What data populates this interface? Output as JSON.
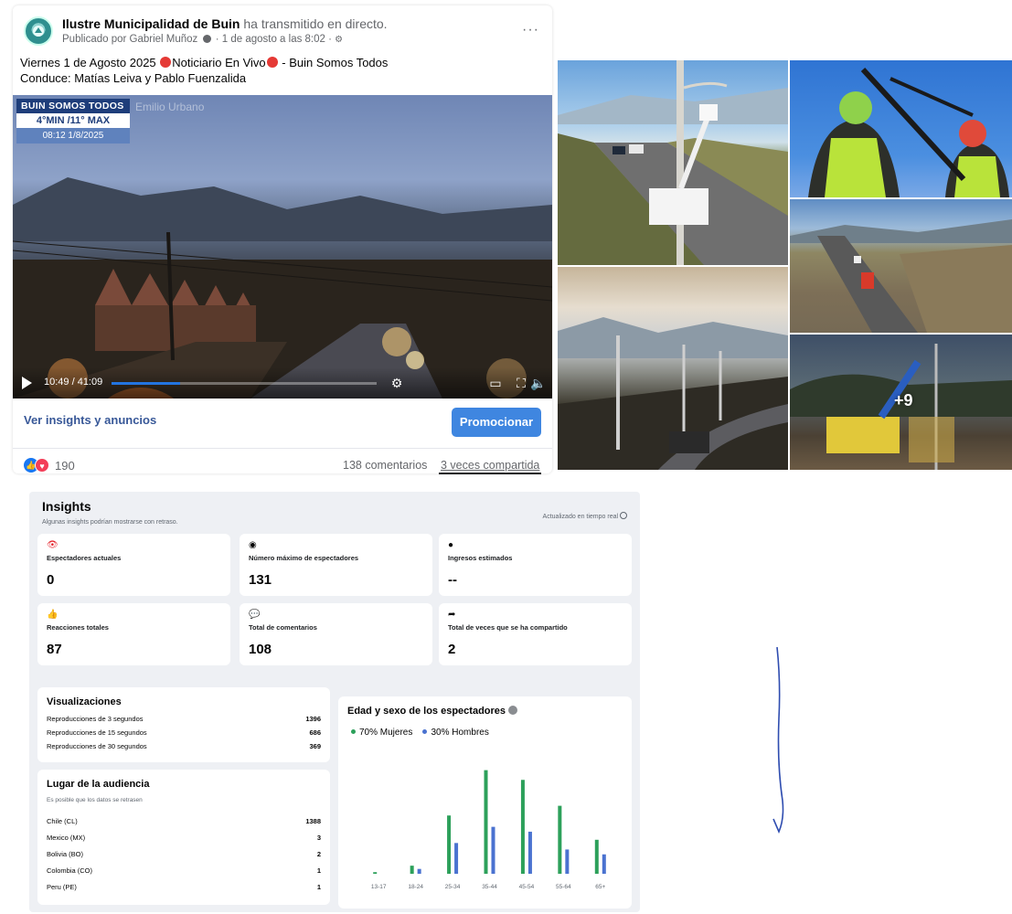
{
  "post": {
    "page_name": "Ilustre Municipalidad de Buin",
    "action_text": "ha transmitido en directo.",
    "published_by": "Publicado por Gabriel Muñoz",
    "date_text": "1 de agosto a las 8:02",
    "more_label": "···",
    "title_part1": "Viernes 1 de Agosto 2025",
    "title_part2": "Noticiario En Vivo",
    "title_part3": "- Buin Somos Todos",
    "subtitle": "Conduce: Matías Leiva y Pablo Fuenzalida",
    "video": {
      "overlay_title": "BUIN SOMOS TODOS",
      "overlay_temp": "4°MIN /11° MAX",
      "overlay_datetime": "08:12 1/8/2025",
      "overlay_extra": "Emilio Urbano",
      "time": "10:49 / 41:09",
      "progress": 0.26
    },
    "insights_link": "Ver insights y anuncios",
    "promote_button": "Promocionar",
    "reaction_count": "190",
    "comments": "138 comentarios",
    "shares": "3 veces compartida"
  },
  "photos": {
    "more_count": "+9"
  },
  "insights": {
    "title": "Insights",
    "subtitle": "Algunas insights podrían mostrarse con retraso.",
    "realtime": "Actualizado en tiempo real",
    "cards": [
      {
        "label": "Espectadores actuales",
        "value": "0",
        "icon": "eye-icon"
      },
      {
        "label": "Número máximo de espectadores",
        "value": "131",
        "icon": "pin-icon"
      },
      {
        "label": "Ingresos estimados",
        "value": "--",
        "icon": "dollar-icon"
      },
      {
        "label": "Reacciones totales",
        "value": "87",
        "icon": "thumbs-up-icon"
      },
      {
        "label": "Total de comentarios",
        "value": "108",
        "icon": "comment-icon"
      },
      {
        "label": "Total de veces que se ha compartido",
        "value": "2",
        "icon": "share-icon"
      }
    ],
    "views": {
      "title": "Visualizaciones",
      "rows": [
        {
          "label": "Reproducciones de 3 segundos",
          "value": "1396"
        },
        {
          "label": "Reproducciones de 15 segundos",
          "value": "686"
        },
        {
          "label": "Reproducciones de 30 segundos",
          "value": "369"
        }
      ]
    },
    "audience": {
      "title": "Lugar de la audiencia",
      "subtitle": "Es posible que los datos se retrasen",
      "rows": [
        {
          "label": "Chile (CL)",
          "value": "1388"
        },
        {
          "label": "Mexico (MX)",
          "value": "3"
        },
        {
          "label": "Bolivia (BO)",
          "value": "2"
        },
        {
          "label": "Colombia (CO)",
          "value": "1"
        },
        {
          "label": "Peru (PE)",
          "value": "1"
        }
      ]
    },
    "age_gender": {
      "title": "Edad y sexo de los espectadores",
      "women": "70% Mujeres",
      "men": "30% Hombres"
    }
  },
  "colors": {
    "women": "#2ca05a",
    "men": "#4a72d0",
    "accent": "#3f86e0"
  },
  "chart_data": {
    "type": "bar",
    "categories": [
      "13-17",
      "18-24",
      "25-34",
      "35-44",
      "45-54",
      "55-64",
      "65+"
    ],
    "series": [
      {
        "name": "Mujeres",
        "values": [
          0.5,
          2.5,
          18,
          32,
          29,
          21,
          10.5
        ]
      },
      {
        "name": "Hombres",
        "values": [
          0,
          1.5,
          9.5,
          14.5,
          13,
          7.5,
          6
        ]
      }
    ],
    "title": "Edad y sexo de los espectadores",
    "xlabel": "",
    "ylabel": "",
    "ylim": [
      0,
      35
    ],
    "grid": false,
    "legend": "top-left"
  }
}
